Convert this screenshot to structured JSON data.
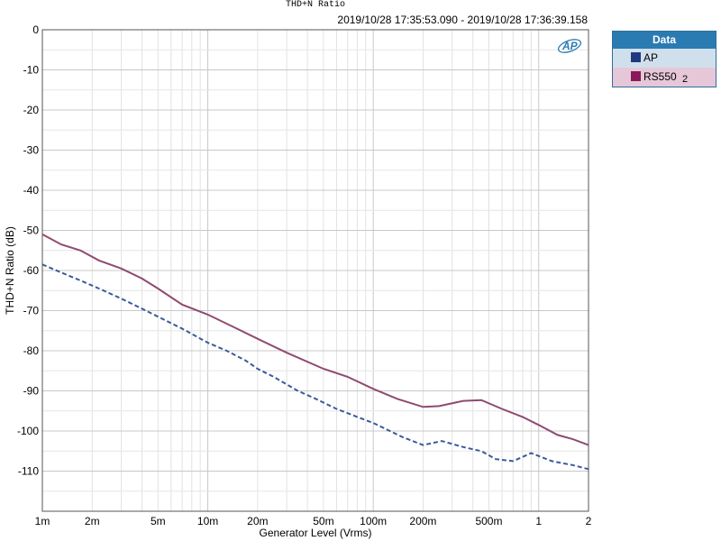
{
  "chart_data": {
    "type": "line",
    "title": "THD+N Ratio",
    "subtitle": "2019/10/28 17:35:53.090 - 2019/10/28 17:36:39.158",
    "xlabel": "Generator Level (Vrms)",
    "ylabel": "THD+N Ratio (dB)",
    "xscale": "log",
    "xlim": [
      0.001,
      2
    ],
    "ylim": [
      -120,
      0
    ],
    "grid": true,
    "legend_placement": "right",
    "xticks": [
      {
        "v": 0.001,
        "label": "1m"
      },
      {
        "v": 0.002,
        "label": "2m"
      },
      {
        "v": 0.005,
        "label": "5m"
      },
      {
        "v": 0.01,
        "label": "10m"
      },
      {
        "v": 0.02,
        "label": "20m"
      },
      {
        "v": 0.05,
        "label": "50m"
      },
      {
        "v": 0.1,
        "label": "100m"
      },
      {
        "v": 0.2,
        "label": "200m"
      },
      {
        "v": 0.5,
        "label": "500m"
      },
      {
        "v": 1,
        "label": "1"
      },
      {
        "v": 2,
        "label": "2"
      }
    ],
    "yticks": [
      0,
      -10,
      -20,
      -30,
      -40,
      -50,
      -60,
      -70,
      -80,
      -90,
      -100,
      -110
    ],
    "series": [
      {
        "name": "AP",
        "color": "#3b5a9a",
        "dash": true,
        "points": [
          [
            0.001,
            -58.5
          ],
          [
            0.0013,
            -60.5
          ],
          [
            0.0017,
            -62.5
          ],
          [
            0.0022,
            -64.5
          ],
          [
            0.003,
            -67
          ],
          [
            0.004,
            -69.5
          ],
          [
            0.005,
            -71.5
          ],
          [
            0.007,
            -74.5
          ],
          [
            0.01,
            -78
          ],
          [
            0.013,
            -80
          ],
          [
            0.017,
            -82.5
          ],
          [
            0.02,
            -84.5
          ],
          [
            0.025,
            -86.5
          ],
          [
            0.035,
            -90
          ],
          [
            0.045,
            -92
          ],
          [
            0.06,
            -94.5
          ],
          [
            0.08,
            -96.5
          ],
          [
            0.1,
            -98
          ],
          [
            0.15,
            -101.5
          ],
          [
            0.2,
            -103.5
          ],
          [
            0.26,
            -102.5
          ],
          [
            0.35,
            -104
          ],
          [
            0.45,
            -105
          ],
          [
            0.55,
            -107
          ],
          [
            0.7,
            -107.5
          ],
          [
            0.9,
            -105.5
          ],
          [
            1.2,
            -107.5
          ],
          [
            1.6,
            -108.5
          ],
          [
            2,
            -109.5
          ]
        ]
      },
      {
        "name": "RS550",
        "color": "#8f4a70",
        "dash": false,
        "points": [
          [
            0.001,
            -51
          ],
          [
            0.0013,
            -53.5
          ],
          [
            0.0017,
            -55
          ],
          [
            0.0022,
            -57.5
          ],
          [
            0.003,
            -59.5
          ],
          [
            0.004,
            -62
          ],
          [
            0.005,
            -64.5
          ],
          [
            0.007,
            -68.5
          ],
          [
            0.01,
            -71
          ],
          [
            0.015,
            -74.5
          ],
          [
            0.02,
            -77
          ],
          [
            0.03,
            -80.5
          ],
          [
            0.05,
            -84.5
          ],
          [
            0.07,
            -86.5
          ],
          [
            0.1,
            -89.5
          ],
          [
            0.14,
            -92
          ],
          [
            0.2,
            -94
          ],
          [
            0.25,
            -93.8
          ],
          [
            0.35,
            -92.5
          ],
          [
            0.45,
            -92.3
          ],
          [
            0.6,
            -94.5
          ],
          [
            0.8,
            -96.5
          ],
          [
            1,
            -98.5
          ],
          [
            1.3,
            -101
          ],
          [
            1.6,
            -102
          ],
          [
            2,
            -103.5
          ]
        ]
      }
    ]
  },
  "legend": {
    "header": "Data",
    "items": [
      {
        "label": "AP",
        "suffix": "",
        "color": "#1f3a80"
      },
      {
        "label": "RS550",
        "suffix": "2",
        "color": "#8a1a5a"
      }
    ]
  },
  "logo_text": "AP"
}
